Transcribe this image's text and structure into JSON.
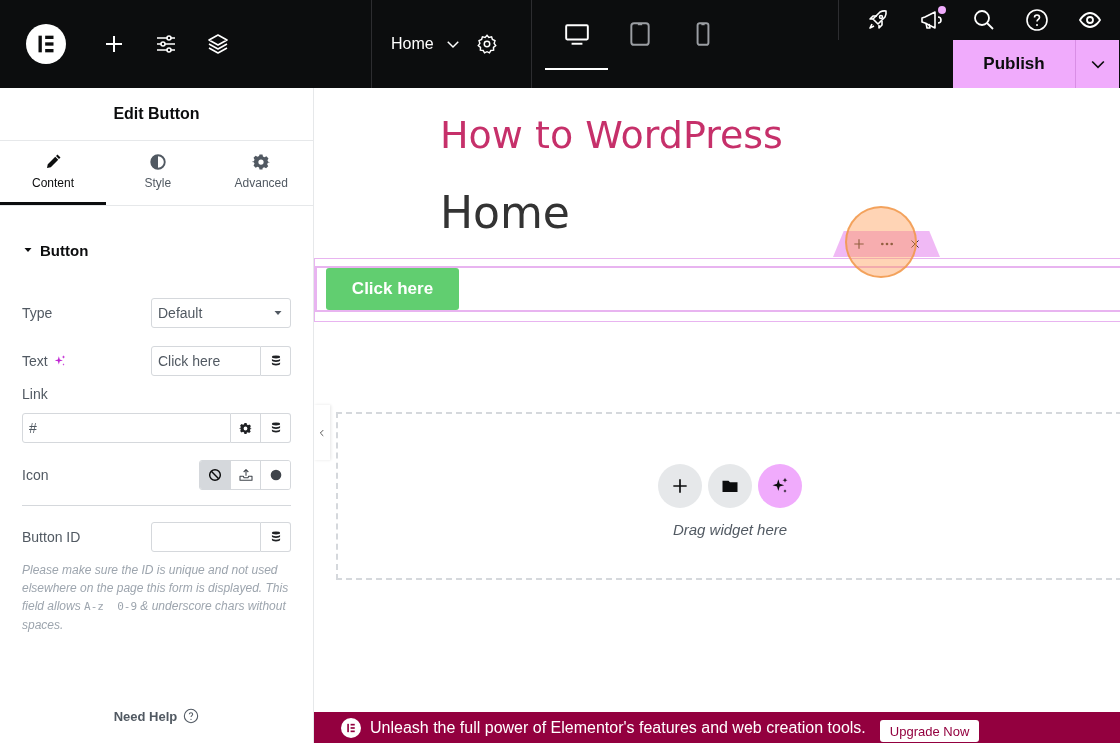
{
  "top_bar": {
    "page_title": "Home",
    "devices": [
      {
        "kind": "desktop",
        "selected": true
      },
      {
        "kind": "tablet",
        "selected": false
      },
      {
        "kind": "mobile",
        "selected": false
      }
    ],
    "notification_dot": true,
    "publish_label": "Publish"
  },
  "panel": {
    "title": "Edit Button",
    "tabs": [
      {
        "kind": "content",
        "label": "Content",
        "selected": true
      },
      {
        "kind": "style",
        "label": "Style",
        "selected": false
      },
      {
        "kind": "advanced",
        "label": "Advanced",
        "selected": false
      }
    ],
    "section": {
      "title": "Button",
      "expanded": true
    },
    "type": {
      "label": "Type",
      "value": "Default"
    },
    "text": {
      "label": "Text",
      "value": "Click here"
    },
    "link": {
      "label": "Link",
      "value": "#"
    },
    "icon": {
      "label": "Icon",
      "options": [
        {
          "kind": "none",
          "selected": true
        },
        {
          "kind": "upload",
          "selected": false
        },
        {
          "kind": "circle",
          "selected": false
        }
      ]
    },
    "button_id": {
      "label": "Button ID"
    },
    "help": {
      "before": "Please make sure the ID is unique and not used elsewhere on the page this form is displayed. This field allows",
      "code": "A-z  0-9",
      "after": "& underscore chars without spaces."
    },
    "need_help": "Need Help"
  },
  "canvas": {
    "site_title": "How to WordPress",
    "heading": "Home",
    "button_label": "Click here",
    "drop_hint": "Drag widget here"
  },
  "promo_bar": {
    "text": "Unleash the full power of Elementor's features and web creation tools.",
    "button": "Upgrade Now"
  }
}
